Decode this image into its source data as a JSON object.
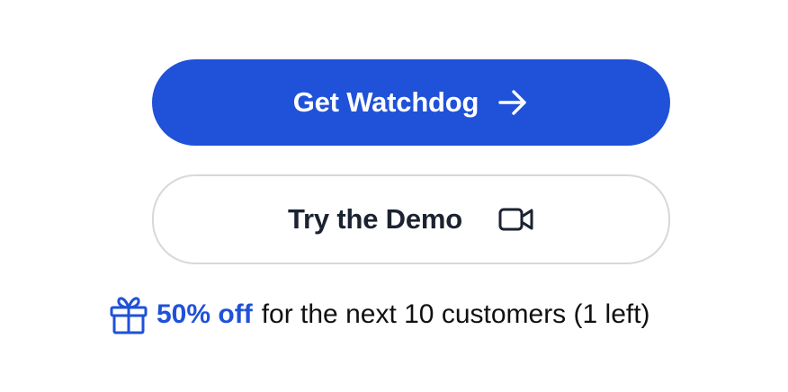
{
  "primary_button": {
    "label": "Get Watchdog",
    "icon": "arrow-right-icon",
    "color": "#1f51d9"
  },
  "secondary_button": {
    "label": "Try the Demo",
    "icon": "video-camera-icon"
  },
  "promo": {
    "icon": "gift-icon",
    "highlight": "50% off",
    "text": "for the next 10 customers (1 left)",
    "highlight_color": "#1f51d9"
  }
}
